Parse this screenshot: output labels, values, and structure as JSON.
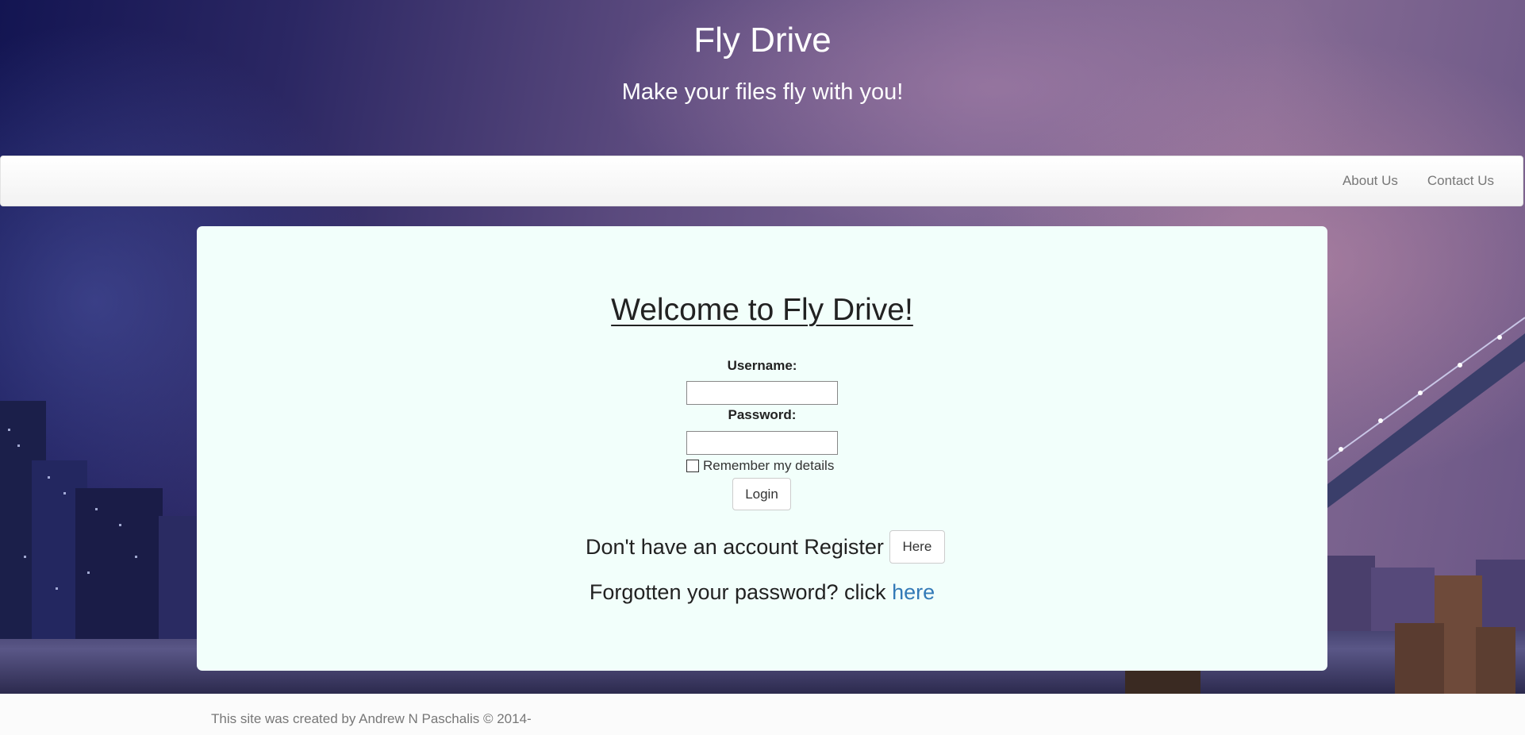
{
  "header": {
    "title": "Fly Drive",
    "tagline": "Make your files fly with you!"
  },
  "nav": {
    "items": [
      {
        "label": "About Us"
      },
      {
        "label": "Contact Us"
      }
    ]
  },
  "login": {
    "heading": "Welcome to Fly Drive!",
    "username_label": "Username:",
    "username_value": "",
    "password_label": "Password:",
    "password_value": "",
    "remember_label": "Remember my details",
    "remember_checked": false,
    "login_button": "Login",
    "register_text": "Don't have an account Register",
    "register_button": "Here",
    "forgot_text": "Forgotten your password? click",
    "forgot_link": "here"
  },
  "footer": {
    "text": "This site was created by Andrew N Paschalis © 2014-"
  },
  "colors": {
    "panel_bg": "#f2fffb",
    "link": "#337ab7",
    "nav_text": "#777777"
  }
}
